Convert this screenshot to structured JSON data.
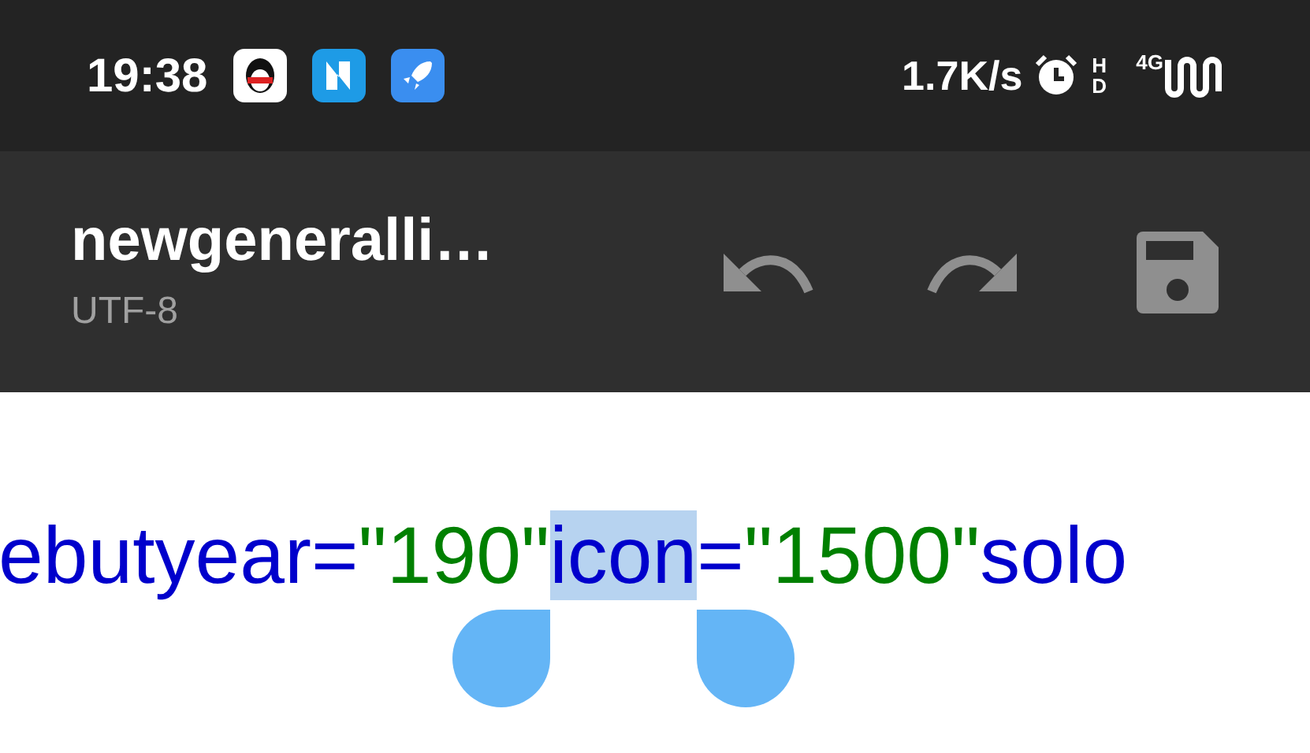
{
  "status_bar": {
    "time": "19:38",
    "net_speed": "1.7K/s",
    "hd_label": "HD",
    "network_type": "4G"
  },
  "toolbar": {
    "file_name": "newgeneralli…",
    "encoding": "UTF-8"
  },
  "editor": {
    "tokens": [
      {
        "text": "ebutyear=",
        "kind": "attr",
        "selected": false
      },
      {
        "text": "\"190\"",
        "kind": "string",
        "selected": false
      },
      {
        "text": "icon",
        "kind": "attr",
        "selected": true
      },
      {
        "text": "=",
        "kind": "attr",
        "selected": false
      },
      {
        "text": "\"1500\"",
        "kind": "string",
        "selected": false
      },
      {
        "text": "solo",
        "kind": "attr",
        "selected": false
      }
    ]
  }
}
